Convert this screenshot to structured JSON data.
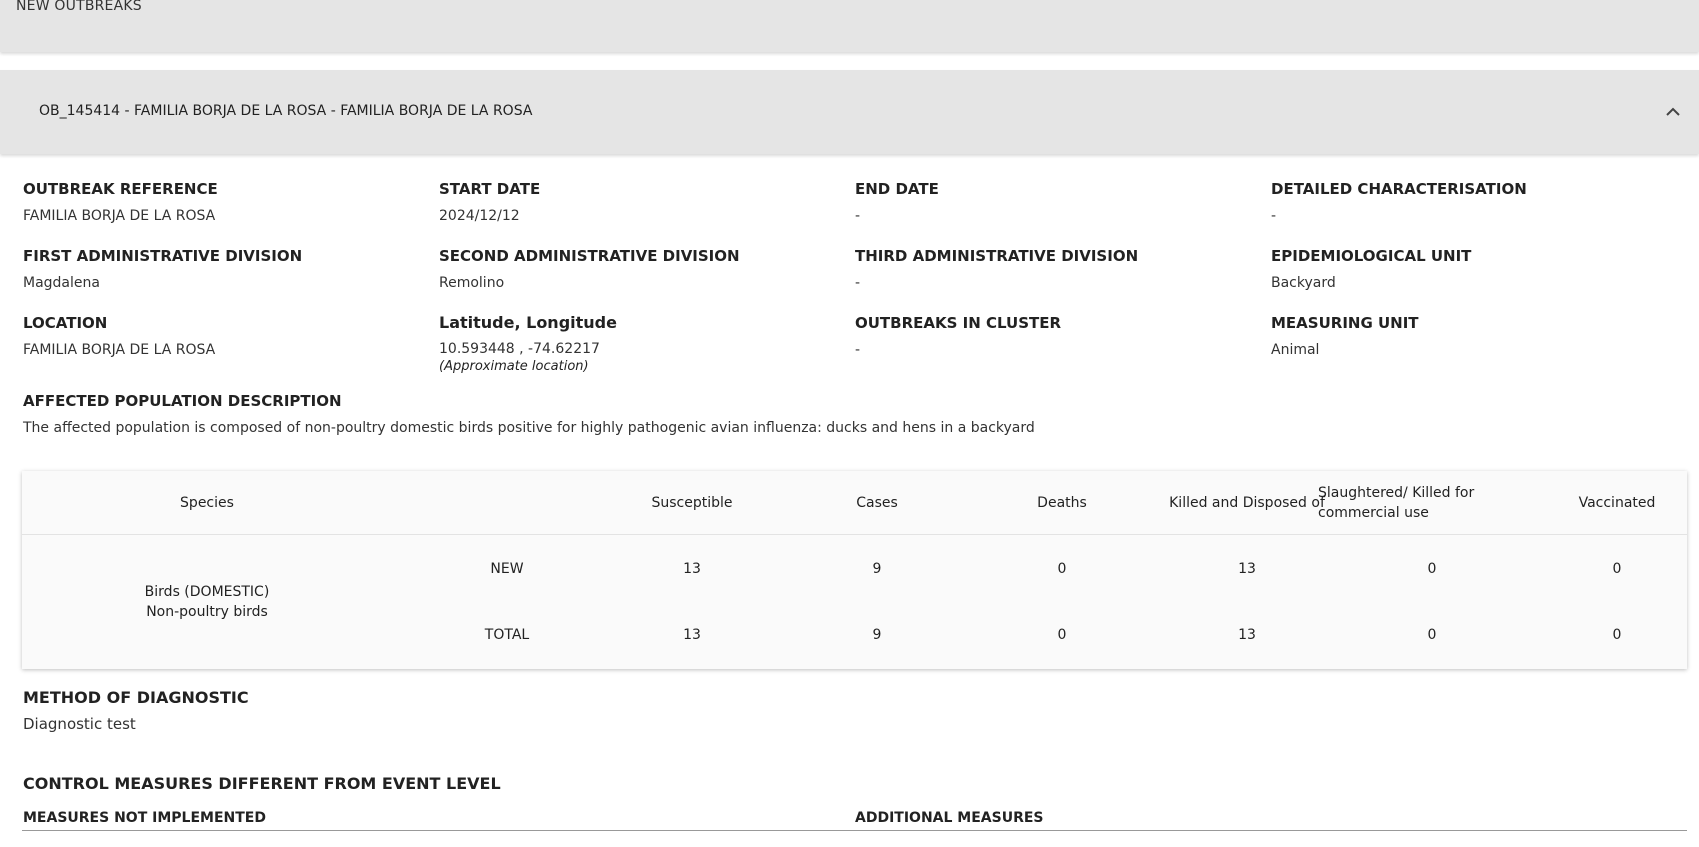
{
  "top_section": {
    "title": "NEW OUTBREAKS"
  },
  "outbreak_header": {
    "title": "OB_145414 - FAMILIA BORJA DE LA ROSA - FAMILIA BORJA DE LA ROSA",
    "chevron": "chevron-up-icon"
  },
  "fields": {
    "outbreak_reference": {
      "label": "OUTBREAK REFERENCE",
      "value": "FAMILIA BORJA DE LA ROSA"
    },
    "start_date": {
      "label": "START DATE",
      "value": "2024/12/12"
    },
    "end_date": {
      "label": "END DATE",
      "value": "-"
    },
    "detailed_characterisation": {
      "label": "DETAILED CHARACTERISATION",
      "value": "-"
    },
    "first_admin": {
      "label": "FIRST ADMINISTRATIVE DIVISION",
      "value": "Magdalena"
    },
    "second_admin": {
      "label": "SECOND ADMINISTRATIVE DIVISION",
      "value": "Remolino"
    },
    "third_admin": {
      "label": "THIRD ADMINISTRATIVE DIVISION",
      "value": "-"
    },
    "epi_unit": {
      "label": "EPIDEMIOLOGICAL UNIT",
      "value": "Backyard"
    },
    "location": {
      "label": "LOCATION",
      "value": "FAMILIA BORJA DE LA ROSA"
    },
    "lat_long": {
      "label": "Latitude, Longitude",
      "value": "10.593448 , -74.62217",
      "note": "(Approximate location)"
    },
    "outbreaks_in_cluster": {
      "label": "OUTBREAKS IN CLUSTER",
      "value": "-"
    },
    "measuring_unit": {
      "label": "MEASURING UNIT",
      "value": "Animal"
    }
  },
  "affected_population": {
    "label": "AFFECTED POPULATION DESCRIPTION",
    "value": "The affected population is composed of non-poultry domestic birds positive for highly pathogenic avian influenza: ducks and hens in a backyard"
  },
  "species_table": {
    "headers": {
      "species": "Species",
      "susceptible": "Susceptible",
      "cases": "Cases",
      "deaths": "Deaths",
      "killed": "Killed and Disposed of",
      "slaughtered": "Slaughtered/ Killed for commercial use",
      "vaccinated": "Vaccinated"
    },
    "species_line1": "Birds (DOMESTIC)",
    "species_line2": "Non-poultry birds",
    "rows": [
      {
        "type": "NEW",
        "susceptible": "13",
        "cases": "9",
        "deaths": "0",
        "killed": "13",
        "slaughtered": "0",
        "vaccinated": "0"
      },
      {
        "type": "TOTAL",
        "susceptible": "13",
        "cases": "9",
        "deaths": "0",
        "killed": "13",
        "slaughtered": "0",
        "vaccinated": "0"
      }
    ]
  },
  "method_of_diagnostic": {
    "label": "METHOD OF DIAGNOSTIC",
    "value": "Diagnostic test"
  },
  "control_measures": {
    "title": "CONTROL MEASURES DIFFERENT FROM EVENT LEVEL",
    "not_implemented": "MEASURES NOT IMPLEMENTED",
    "additional": "ADDITIONAL MEASURES"
  }
}
